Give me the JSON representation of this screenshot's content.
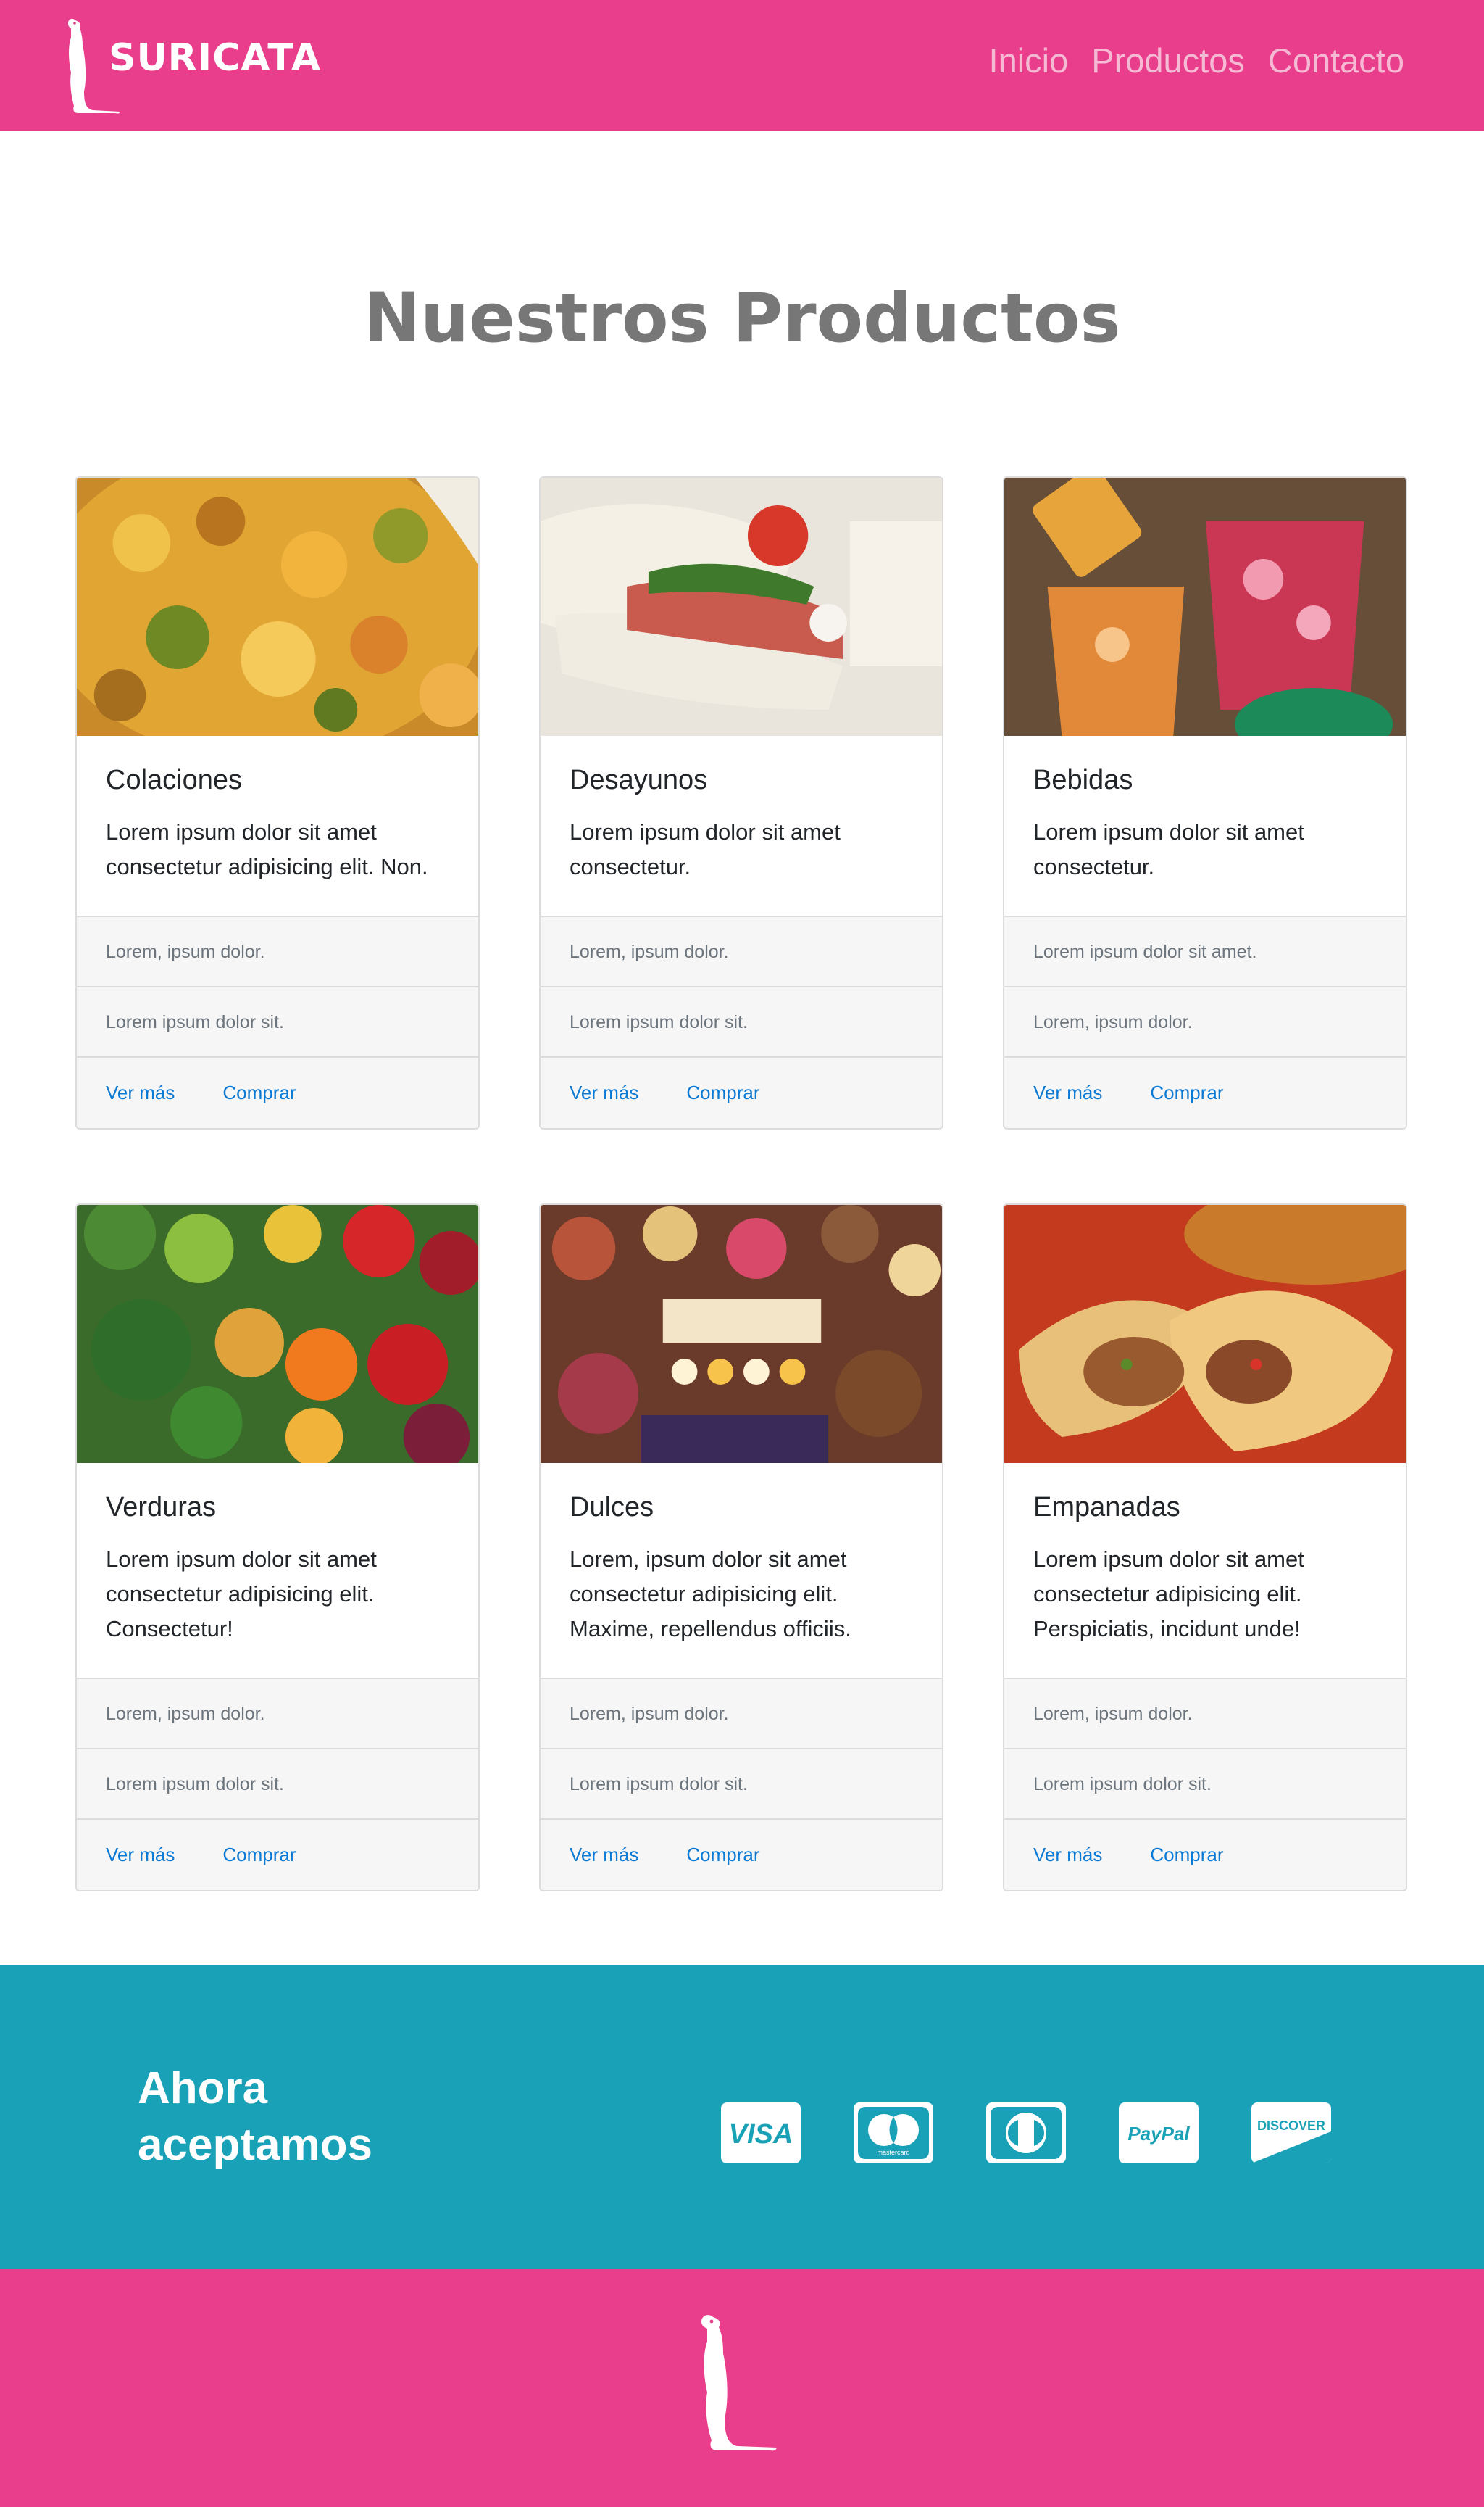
{
  "header": {
    "brand": "SURICATA",
    "nav": [
      "Inicio",
      "Productos",
      "Contacto"
    ]
  },
  "main": {
    "title": "Nuestros Productos",
    "cards": [
      {
        "title": "Colaciones",
        "text": "Lorem ipsum dolor sit amet consectetur adipisicing elit. Non.",
        "items": [
          "Lorem, ipsum dolor.",
          "Lorem ipsum dolor sit."
        ],
        "links": [
          "Ver más",
          "Comprar"
        ]
      },
      {
        "title": "Desayunos",
        "text": "Lorem ipsum dolor sit amet consectetur.",
        "items": [
          "Lorem, ipsum dolor.",
          "Lorem ipsum dolor sit."
        ],
        "links": [
          "Ver más",
          "Comprar"
        ]
      },
      {
        "title": "Bebidas",
        "text": "Lorem ipsum dolor sit amet consectetur.",
        "items": [
          "Lorem ipsum dolor sit amet.",
          "Lorem, ipsum dolor."
        ],
        "links": [
          "Ver más",
          "Comprar"
        ]
      },
      {
        "title": "Verduras",
        "text": "Lorem ipsum dolor sit amet consectetur adipisicing elit. Consectetur!",
        "items": [
          "Lorem, ipsum dolor.",
          "Lorem ipsum dolor sit."
        ],
        "links": [
          "Ver más",
          "Comprar"
        ]
      },
      {
        "title": "Dulces",
        "text": "Lorem, ipsum dolor sit amet consectetur adipisicing elit. Maxime, repellendus officiis.",
        "items": [
          "Lorem, ipsum dolor.",
          "Lorem ipsum dolor sit."
        ],
        "links": [
          "Ver más",
          "Comprar"
        ]
      },
      {
        "title": "Empanadas",
        "text": "Lorem ipsum dolor sit amet consectetur adipisicing elit. Perspiciatis, incidunt unde!",
        "items": [
          "Lorem, ipsum dolor.",
          "Lorem ipsum dolor sit."
        ],
        "links": [
          "Ver más",
          "Comprar"
        ]
      }
    ]
  },
  "payments": {
    "title_line1": "Ahora",
    "title_line2": "aceptamos",
    "methods": [
      "VISA",
      "mastercard",
      "diners-club",
      "PayPal",
      "DISCOVER"
    ]
  },
  "colors": {
    "brand_pink": "#e83e8c",
    "nav_link": "#f5b9d3",
    "teal": "#19a2b7",
    "link_blue": "#0b7ad5"
  },
  "icons": [
    "meerkat-logo-icon",
    "visa-icon",
    "mastercard-icon",
    "diners-club-icon",
    "paypal-icon",
    "discover-icon"
  ]
}
